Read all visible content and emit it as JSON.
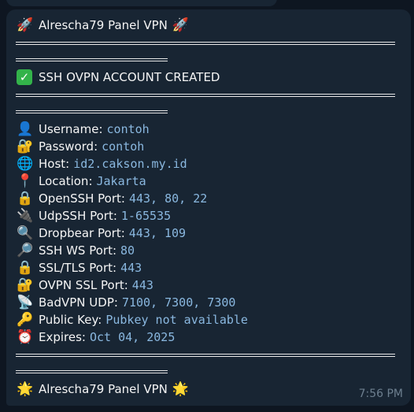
{
  "message": {
    "header_title": "Alrescha79 Panel VPN",
    "created_title": "SSH OVPN ACCOUNT CREATED",
    "footer_title": "Alrescha79 Panel VPN",
    "time": "7:56 PM",
    "fields": [
      {
        "icon": "👤",
        "icon_name": "user-icon",
        "label": "Username:",
        "value": "contoh"
      },
      {
        "icon": "🔐",
        "icon_name": "lock-key-icon",
        "label": "Password:",
        "value": "contoh"
      },
      {
        "icon": "🌐",
        "icon_name": "globe-icon",
        "label": "Host:",
        "value": "id2.cakson.my.id"
      },
      {
        "icon": "📍",
        "icon_name": "pin-icon",
        "label": "Location:",
        "value": "Jakarta"
      },
      {
        "icon": "🔒",
        "icon_name": "lock-icon",
        "label": "OpenSSH Port:",
        "value": "443, 80, 22"
      },
      {
        "icon": "🔌",
        "icon_name": "plug-icon",
        "label": "UdpSSH Port:",
        "value": "1-65535"
      },
      {
        "icon": "🔍",
        "icon_name": "magnifier-icon",
        "label": "Dropbear Port:",
        "value": "443, 109"
      },
      {
        "icon": "🔎",
        "icon_name": "magnifier-right-icon",
        "label": "SSH WS Port:",
        "value": "80"
      },
      {
        "icon": "🔒",
        "icon_name": "lock-icon",
        "label": "SSL/TLS Port:",
        "value": "443"
      },
      {
        "icon": "🔐",
        "icon_name": "lock-key-icon",
        "label": "OVPN SSL Port:",
        "value": "443"
      },
      {
        "icon": "📡",
        "icon_name": "satellite-icon",
        "label": "BadVPN UDP:",
        "value": "7100, 7300, 7300"
      },
      {
        "icon": "🔑",
        "icon_name": "key-icon",
        "label": "Public Key:",
        "value": "Pubkey not available"
      },
      {
        "icon": "⏰",
        "icon_name": "alarm-clock-icon",
        "label": "Expires:",
        "value": "Oct 04, 2025"
      }
    ]
  },
  "colors": {
    "background": "#0e1621",
    "bubble": "#182533",
    "value_text": "#8ab8e0",
    "timestamp": "#6d7f8f",
    "check": "#33b34a"
  }
}
